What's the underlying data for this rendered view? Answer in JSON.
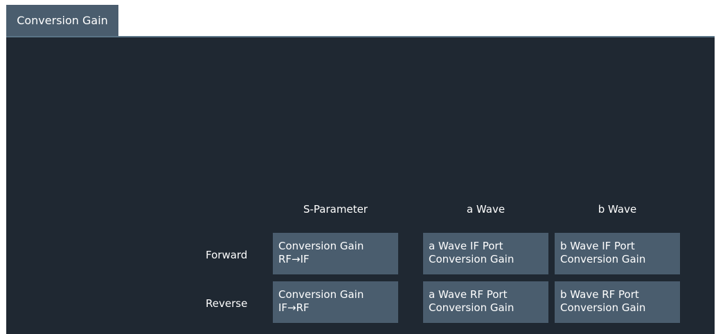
{
  "tab": {
    "label": "Conversion Gain"
  },
  "columns": [
    "S-Parameter",
    "a Wave",
    "b Wave"
  ],
  "rows": [
    {
      "label": "Forward",
      "buttons": [
        {
          "line1": "Conversion Gain",
          "line2": "RF→IF"
        },
        {
          "line1": "a Wave IF Port",
          "line2": "Conversion Gain"
        },
        {
          "line1": "b Wave IF Port",
          "line2": "Conversion Gain"
        }
      ]
    },
    {
      "label": "Reverse",
      "buttons": [
        {
          "line1": "Conversion Gain",
          "line2": "IF→RF"
        },
        {
          "line1": "a Wave RF Port",
          "line2": "Conversion Gain"
        },
        {
          "line1": "b Wave RF Port",
          "line2": "Conversion Gain"
        }
      ]
    }
  ]
}
